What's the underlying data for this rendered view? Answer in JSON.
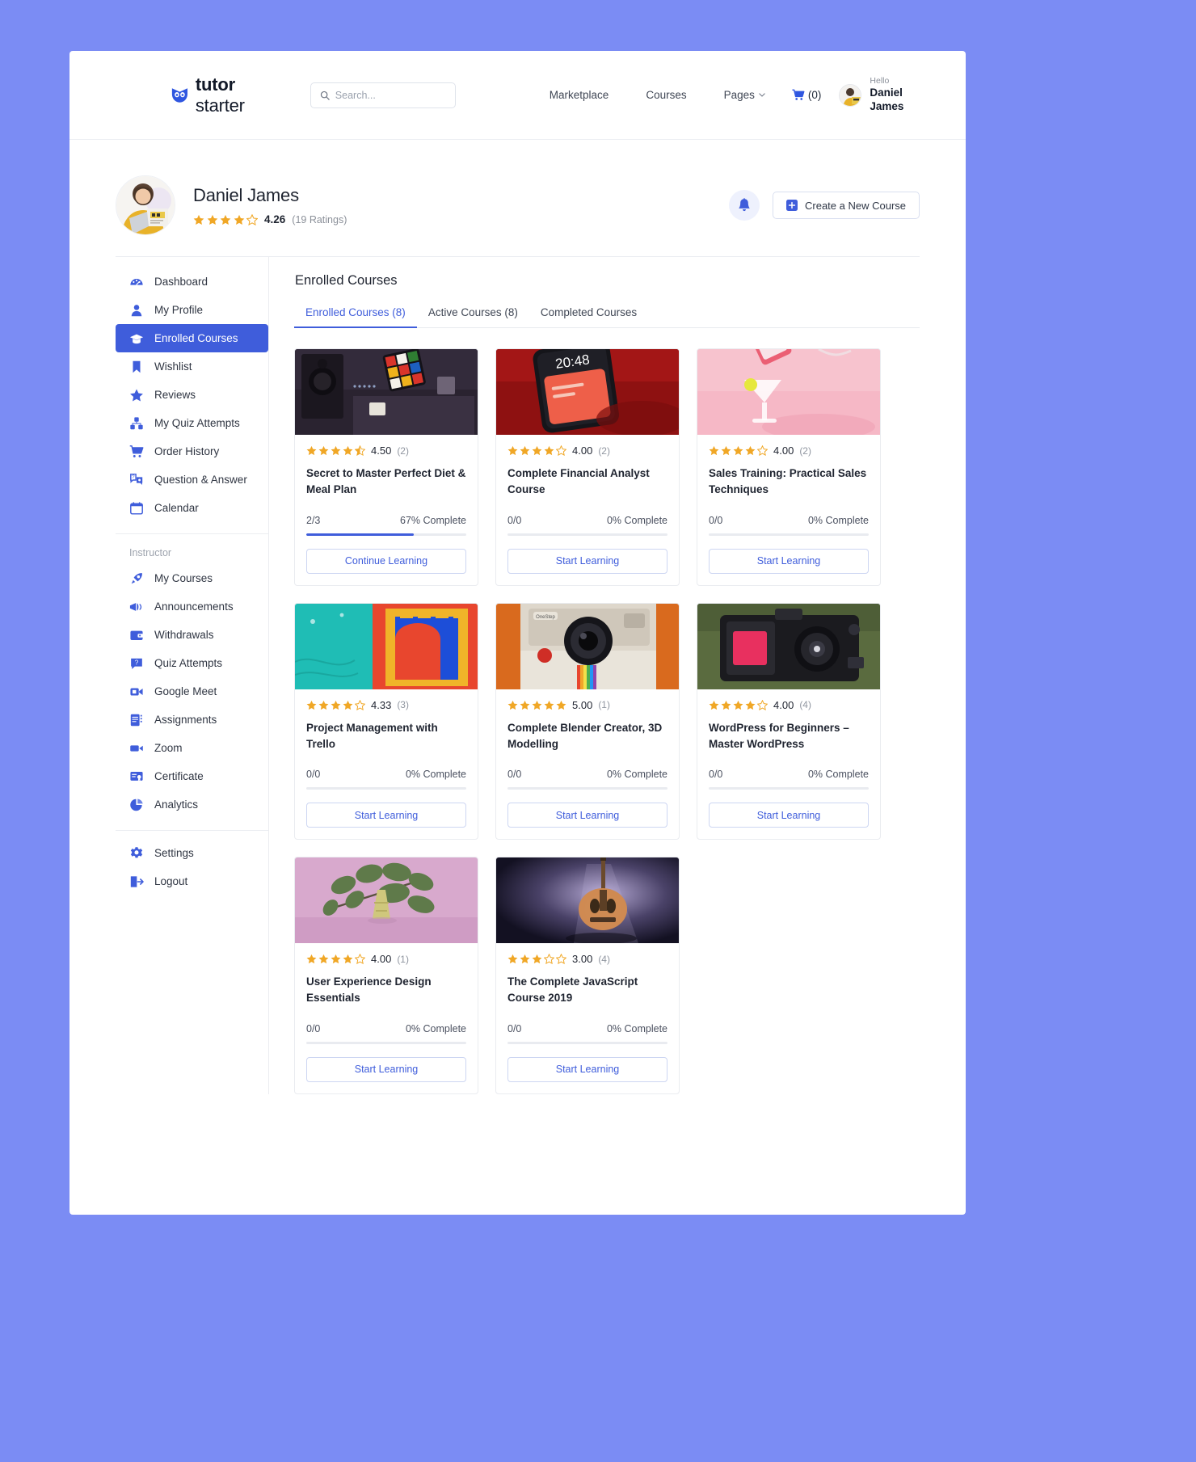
{
  "brand": {
    "bold": "tutor",
    "light": " starter",
    "icon": "owl-icon"
  },
  "search": {
    "placeholder": "Search...",
    "value": ""
  },
  "nav": {
    "links": [
      {
        "label": "Marketplace",
        "has_caret": false
      },
      {
        "label": "Courses",
        "has_caret": false
      },
      {
        "label": "Pages",
        "has_caret": true
      }
    ],
    "cart_label": "(0)",
    "hello": "Hello",
    "user_name": "Daniel James"
  },
  "profile": {
    "name": "Daniel James",
    "rating_value": "4.26",
    "rating_count": "(19 Ratings)",
    "stars_filled": 4,
    "stars_total": 5,
    "create_button": "Create a New Course",
    "bell": "notification-bell-icon"
  },
  "sidebar": {
    "primary": [
      {
        "label": "Dashboard",
        "icon": "dashboard-icon",
        "active": false
      },
      {
        "label": "My Profile",
        "icon": "user-icon",
        "active": false
      },
      {
        "label": "Enrolled Courses",
        "icon": "graduation-cap-icon",
        "active": true
      },
      {
        "label": "Wishlist",
        "icon": "bookmark-icon",
        "active": false
      },
      {
        "label": "Reviews",
        "icon": "star-icon",
        "active": false
      },
      {
        "label": "My Quiz Attempts",
        "icon": "quiz-icon",
        "active": false
      },
      {
        "label": "Order History",
        "icon": "cart-icon",
        "active": false
      },
      {
        "label": "Question & Answer",
        "icon": "question-answer-icon",
        "active": false
      },
      {
        "label": "Calendar",
        "icon": "calendar-icon",
        "active": false
      }
    ],
    "group_title": "Instructor",
    "instructor": [
      {
        "label": "My Courses",
        "icon": "rocket-icon",
        "active": false
      },
      {
        "label": "Announcements",
        "icon": "megaphone-icon",
        "active": false
      },
      {
        "label": "Withdrawals",
        "icon": "wallet-icon",
        "active": false
      },
      {
        "label": "Quiz Attempts",
        "icon": "quiz-badge-icon",
        "active": false
      },
      {
        "label": "Google Meet",
        "icon": "video-camera-icon",
        "active": false
      },
      {
        "label": "Assignments",
        "icon": "assignment-icon",
        "active": false
      },
      {
        "label": "Zoom",
        "icon": "zoom-video-icon",
        "active": false
      },
      {
        "label": "Certificate",
        "icon": "certificate-icon",
        "active": false
      },
      {
        "label": "Analytics",
        "icon": "pie-chart-icon",
        "active": false
      }
    ],
    "footer": [
      {
        "label": "Settings",
        "icon": "gear-icon",
        "active": false
      },
      {
        "label": "Logout",
        "icon": "logout-icon",
        "active": false
      }
    ]
  },
  "main": {
    "title": "Enrolled Courses",
    "tabs": [
      {
        "label": "Enrolled Courses (8)",
        "active": true
      },
      {
        "label": "Active Courses (8)",
        "active": false
      },
      {
        "label": "Completed Courses",
        "active": false
      }
    ],
    "courses": [
      {
        "title": "Secret to Master Perfect Diet & Meal Plan",
        "rating_value": "4.50",
        "rating_count": "(2)",
        "stars_filled": 4,
        "stars_half": true,
        "progress_frac": "2/3",
        "progress_pct": "67% Complete",
        "progress_value": 67,
        "button": "Continue Learning",
        "thumb": "dark-studio-rubiks-cube"
      },
      {
        "title": "Complete Financial Analyst Course",
        "rating_value": "4.00",
        "rating_count": "(2)",
        "stars_filled": 4,
        "stars_half": false,
        "progress_frac": "0/0",
        "progress_pct": "0% Complete",
        "progress_value": 0,
        "button": "Start Learning",
        "thumb": "red-phone-screen"
      },
      {
        "title": "Sales Training: Practical Sales Techniques",
        "rating_value": "4.00",
        "rating_count": "(2)",
        "stars_filled": 4,
        "stars_half": false,
        "progress_frac": "0/0",
        "progress_pct": "0% Complete",
        "progress_value": 0,
        "button": "Start Learning",
        "thumb": "pink-drink-pour"
      },
      {
        "title": "Project Management with Trello",
        "rating_value": "4.33",
        "rating_count": "(3)",
        "stars_filled": 4,
        "stars_half": false,
        "progress_frac": "0/0",
        "progress_pct": "0% Complete",
        "progress_value": 0,
        "button": "Start Learning",
        "thumb": "teal-red-window-mural"
      },
      {
        "title": "Complete Blender Creator, 3D Modelling",
        "rating_value": "5.00",
        "rating_count": "(1)",
        "stars_filled": 5,
        "stars_half": false,
        "progress_frac": "0/0",
        "progress_pct": "0% Complete",
        "progress_value": 0,
        "button": "Start Learning",
        "thumb": "polaroid-camera"
      },
      {
        "title": "WordPress for Beginners – Master WordPress",
        "rating_value": "4.00",
        "rating_count": "(4)",
        "stars_filled": 4,
        "stars_half": false,
        "progress_frac": "0/0",
        "progress_pct": "0% Complete",
        "progress_value": 0,
        "button": "Start Learning",
        "thumb": "black-film-camera-green"
      },
      {
        "title": "User Experience Design Essentials",
        "rating_value": "4.00",
        "rating_count": "(1)",
        "stars_filled": 4,
        "stars_half": false,
        "progress_frac": "0/0",
        "progress_pct": "0% Complete",
        "progress_value": 0,
        "button": "Start Learning",
        "thumb": "pink-leaves-cone"
      },
      {
        "title": "The Complete JavaScript Course 2019",
        "rating_value": "3.00",
        "rating_count": "(4)",
        "stars_filled": 3,
        "stars_half": false,
        "progress_frac": "0/0",
        "progress_pct": "0% Complete",
        "progress_value": 0,
        "button": "Start Learning",
        "thumb": "guitar-spotlight"
      }
    ]
  },
  "colors": {
    "accent": "#3f5ddb",
    "star": "#f0a726",
    "page_bg": "#7b8cf4",
    "text": "#1f2430"
  }
}
